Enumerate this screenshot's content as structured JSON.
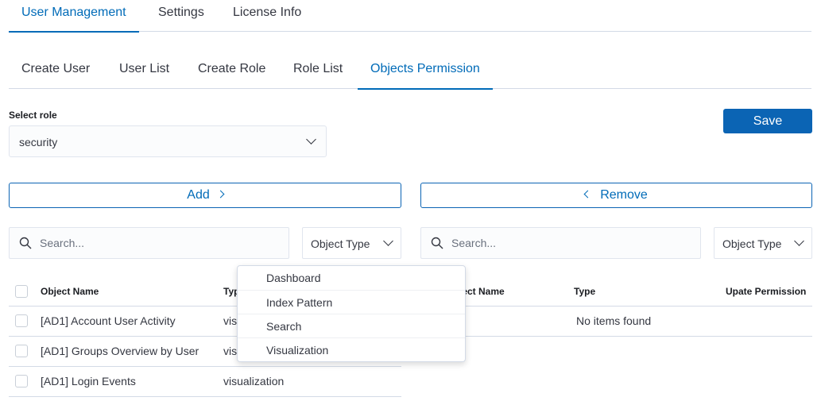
{
  "top_tabs": [
    "User Management",
    "Settings",
    "License Info"
  ],
  "sub_tabs": [
    "Create User",
    "User List",
    "Create Role",
    "Role List",
    "Objects Permission"
  ],
  "select_role": {
    "label": "Select role",
    "value": "security"
  },
  "save_label": "Save",
  "add_label": "Add",
  "remove_label": "Remove",
  "left": {
    "search_placeholder": "Search...",
    "filter_label": "Object Type",
    "columns": {
      "name": "Object Name",
      "type": "Typ"
    },
    "rows": [
      {
        "name": "[AD1] Account User Activity",
        "type": "vis"
      },
      {
        "name": "[AD1] Groups Overview by User",
        "type": "vis"
      },
      {
        "name": "[AD1] Login Events",
        "type": "visualization"
      }
    ]
  },
  "right": {
    "search_placeholder": "Search...",
    "filter_label": "Object Type",
    "columns": {
      "name": "ject Name",
      "type": "Type",
      "permission": "Upate Permission"
    },
    "empty_message": "No items found"
  },
  "object_type_dropdown": [
    "Dashboard",
    "Index Pattern",
    "Search",
    "Visualization"
  ],
  "colors": {
    "accent": "#006bb8",
    "primary_button": "#0b64b4",
    "border": "#d3dae6"
  }
}
